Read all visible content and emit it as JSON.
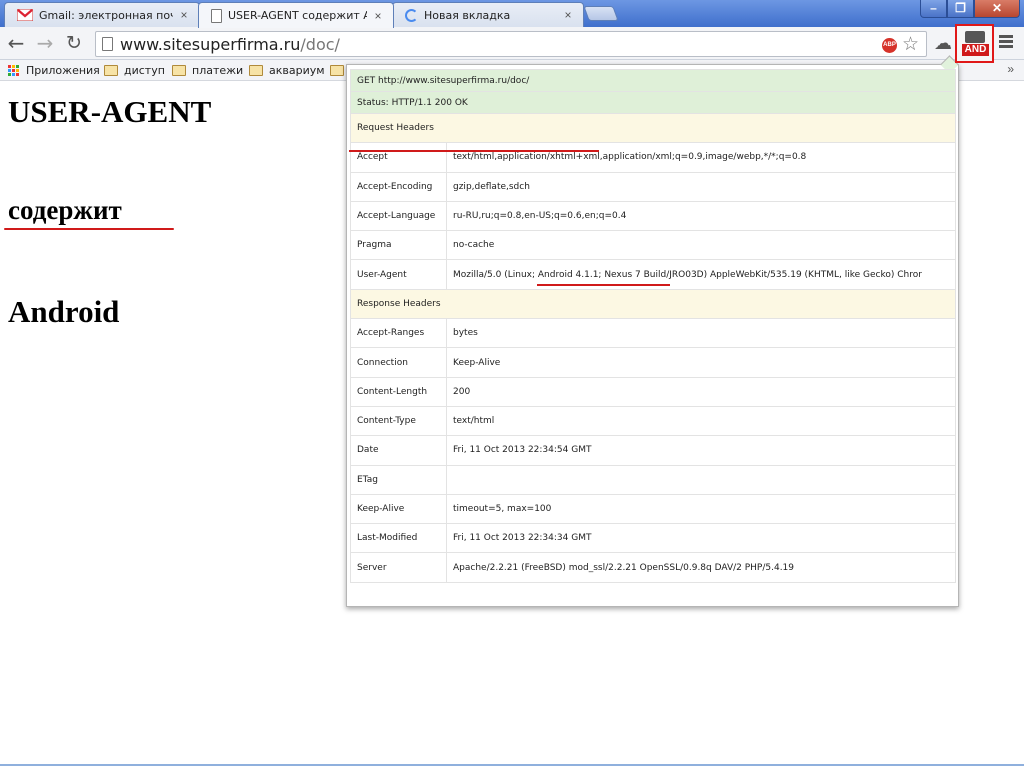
{
  "tabs": [
    {
      "title": "Gmail: электронная почта с",
      "close": "×"
    },
    {
      "title": "USER-AGENT содержит And",
      "close": "×"
    },
    {
      "title": "Новая вкладка",
      "close": "×"
    }
  ],
  "window_controls": {
    "minimize": "–",
    "restore": "❐",
    "close": "✕"
  },
  "toolbar": {
    "back": "←",
    "forward": "→",
    "reload": "↻",
    "url_host": "www.sitesuperfirma.ru",
    "url_path": "/doc/",
    "abp_label": "ABP",
    "star": "☆",
    "cloud": "☁",
    "extension_label": "AND"
  },
  "bookmarks": [
    {
      "label": "Приложения",
      "type": "apps"
    },
    {
      "label": "диступ",
      "type": "folder"
    },
    {
      "label": "платежи",
      "type": "folder"
    },
    {
      "label": "аквариум",
      "type": "folder"
    }
  ],
  "bookmarks_overflow": "»",
  "page": {
    "heading1": "USER-AGENT",
    "heading2": "содержит",
    "heading3": "Android"
  },
  "popup": {
    "request_line": "GET http://www.sitesuperfirma.ru/doc/",
    "status_line": "Status: HTTP/1.1 200 OK",
    "request_section": "Request Headers",
    "request_headers": [
      {
        "key": "Accept",
        "value": "text/html,application/xhtml+xml,application/xml;q=0.9,image/webp,*/*;q=0.8"
      },
      {
        "key": "Accept-Encoding",
        "value": "gzip,deflate,sdch"
      },
      {
        "key": "Accept-Language",
        "value": "ru-RU,ru;q=0.8,en-US;q=0.6,en;q=0.4"
      },
      {
        "key": "Pragma",
        "value": "no-cache"
      },
      {
        "key": "User-Agent",
        "value": "Mozilla/5.0 (Linux; Android 4.1.1; Nexus 7 Build/JRO03D) AppleWebKit/535.19 (KHTML, like Gecko) Chror"
      }
    ],
    "response_section": "Response Headers",
    "response_headers": [
      {
        "key": "Accept-Ranges",
        "value": "bytes"
      },
      {
        "key": "Connection",
        "value": "Keep-Alive"
      },
      {
        "key": "Content-Length",
        "value": "200"
      },
      {
        "key": "Content-Type",
        "value": "text/html"
      },
      {
        "key": "Date",
        "value": "Fri, 11 Oct 2013 22:34:54 GMT"
      },
      {
        "key": "ETag",
        "value": ""
      },
      {
        "key": "Keep-Alive",
        "value": "timeout=5, max=100"
      },
      {
        "key": "Last-Modified",
        "value": "Fri, 11 Oct 2013 22:34:34 GMT"
      },
      {
        "key": "Server",
        "value": "Apache/2.2.21 (FreeBSD) mod_ssl/2.2.21 OpenSSL/0.9.8q DAV/2 PHP/5.4.19"
      }
    ]
  },
  "colors": {
    "annotation": "#d01a1a",
    "request_row": "#dff0d8",
    "section_row": "#fcf8e3"
  }
}
